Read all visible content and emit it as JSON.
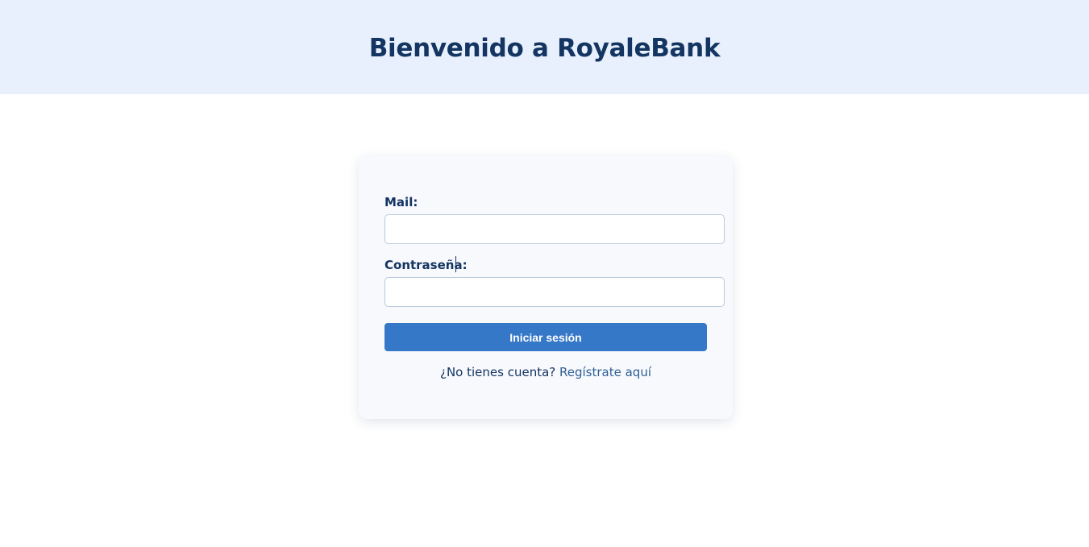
{
  "header": {
    "title": "Bienvenido a RoyaleBank"
  },
  "login": {
    "mail_label": "Mail:",
    "mail_value": "",
    "password_label": "Contraseña:",
    "password_value": "",
    "submit_label": "Iniciar sesión",
    "register_prompt": "¿No tienes cuenta?",
    "register_link": "Regístrate aquí"
  },
  "colors": {
    "header_bg": "#e7f0fc",
    "title": "#143461",
    "button": "#3578c8",
    "link": "#2f5f94",
    "card_bg": "#f7f9fd"
  }
}
